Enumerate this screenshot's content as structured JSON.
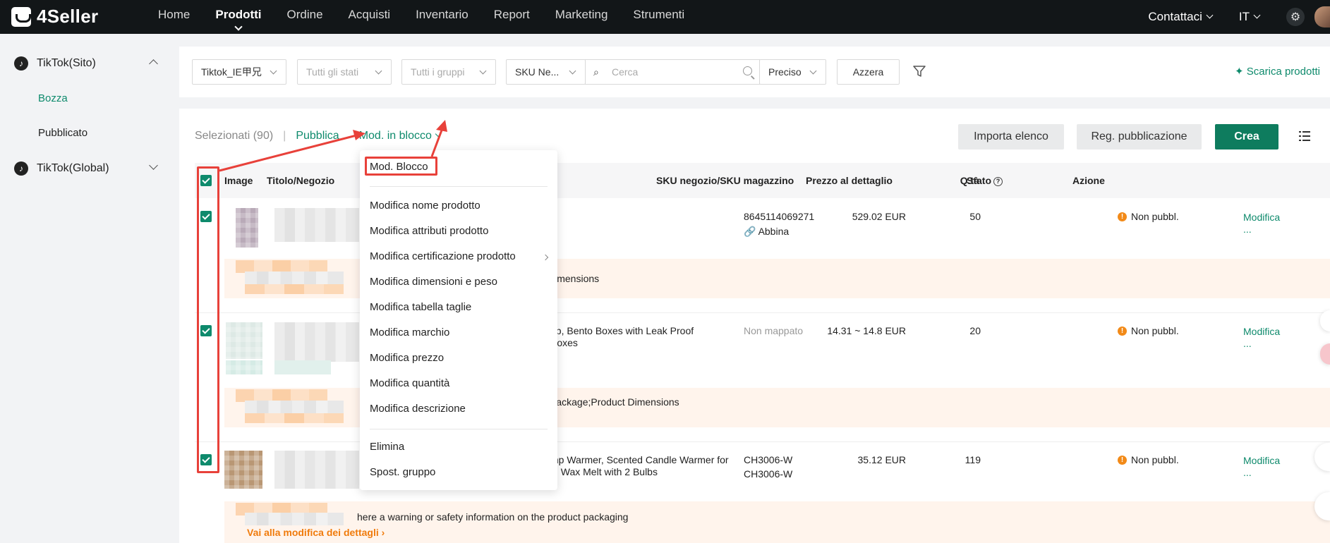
{
  "brand": {
    "name": "4Seller"
  },
  "nav": {
    "items": [
      "Home",
      "Prodotti",
      "Ordine",
      "Acquisti",
      "Inventario",
      "Report",
      "Marketing",
      "Strumenti"
    ],
    "active": "Prodotti"
  },
  "topbar": {
    "contact": "Contattaci",
    "lang": "IT"
  },
  "sidebar": {
    "group1": "TikTok(Sito)",
    "sub1": "Bozza",
    "sub2": "Pubblicato",
    "group2": "TikTok(Global)"
  },
  "filters": {
    "shop": "Tiktok_IE甲兄",
    "state": "Tutti gli stati",
    "groups": "Tutti i gruppi",
    "field": "SKU Ne...",
    "search_placeholder": "Cerca",
    "match": "Preciso",
    "reset": "Azzera",
    "download": "Scarica prodotti"
  },
  "toolbar": {
    "selected": "Selezionati (90)",
    "publish": "Pubblica",
    "bulk_edit": "Mod. in blocco",
    "import": "Importa elenco",
    "publish_log": "Reg. pubblicazione",
    "create": "Crea"
  },
  "table": {
    "headers": {
      "image": "Image",
      "title": "Titolo/Negozio",
      "sku": "SKU negozio/SKU magazzino",
      "price": "Prezzo al dettaglio",
      "qty": "Q.tà",
      "status": "Stato",
      "action": "Azione"
    },
    "rows": [
      {
        "title": "",
        "sku1": "8645114069271",
        "sku2": "Abbina",
        "price": "529.02 EUR",
        "qty": "50",
        "status": "Non pubbl.",
        "action": "Modifica",
        "more": "...",
        "warning": "Dimensions",
        "warning_link": ""
      },
      {
        "title": "ep, Bento Boxes with Leak Proof\nBoxes",
        "sku1": "Non mappato",
        "sku2": "",
        "price": "14.31 ~ 14.8 EUR",
        "qty": "20",
        "status": "Non pubbl.",
        "action": "Modifica",
        "more": "...",
        "warning": "Package;Product Dimensions",
        "warning_link": ""
      },
      {
        "title": "mp Warmer, Scented Candle Warmer for\ns, Wax Melt with 2 Bulbs",
        "sku1": "CH3006-W",
        "sku2": "CH3006-W",
        "price": "35.12 EUR",
        "qty": "119",
        "status": "Non pubbl.",
        "action": "Modifica",
        "more": "...",
        "warning": "here a warning or safety information on the product packaging",
        "warning_link": "Vai alla modifica dei dettagli"
      }
    ]
  },
  "dropdown": {
    "header": "Mod. Blocco",
    "items": [
      "Modifica nome prodotto",
      "Modifica attributi prodotto",
      "Modifica certificazione prodotto",
      "Modifica dimensioni e peso",
      "Modifica tabella taglie",
      "Modifica marchio",
      "Modifica prezzo",
      "Modifica quantità",
      "Modifica descrizione"
    ],
    "footer": [
      "Elimina",
      "Spost. gruppo"
    ]
  },
  "colors": {
    "accent": "#0e8a6c",
    "annotation": "#e8413a",
    "warning": "#f28a18"
  }
}
